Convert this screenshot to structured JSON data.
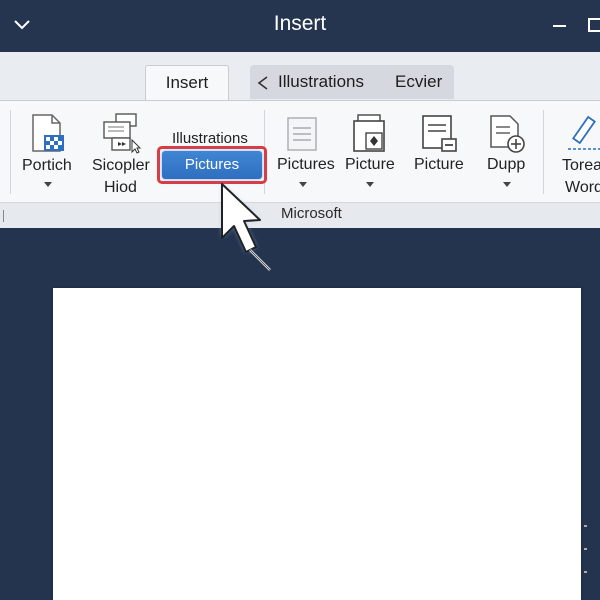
{
  "window": {
    "title": "Insert"
  },
  "tabs": {
    "active": "Insert",
    "inactive": [
      "Illustrations",
      "Ecvier"
    ]
  },
  "ribbon": {
    "portich": {
      "label": "Portich",
      "icon": "image-file-icon"
    },
    "sicopler": {
      "label_line1": "Sicopler",
      "label_line2": "Hiod",
      "icon": "stacked-screens-icon"
    },
    "illustrations_heading": "Illustrations",
    "pictures_button": "Pictures",
    "pictures_dd": {
      "label": "Pictures",
      "icon": "document-lines-icon"
    },
    "picture_dd": {
      "label": "Picture",
      "icon": "picture-document-icon"
    },
    "picture2": {
      "label": "Picture",
      "icon": "document-minus-icon"
    },
    "dupp": {
      "label": "Dupp",
      "icon": "document-plus-icon"
    },
    "torea": {
      "label_line1": "Torea",
      "label_line2": "Word",
      "icon": "pen-edit-icon"
    },
    "group_label": "Microsoft"
  },
  "colors": {
    "title_bar": "#25354f",
    "ribbon": "#f7f8f9",
    "highlight": "#e0393b",
    "button_blue": "#3577c9",
    "backdrop": "#24344f"
  }
}
